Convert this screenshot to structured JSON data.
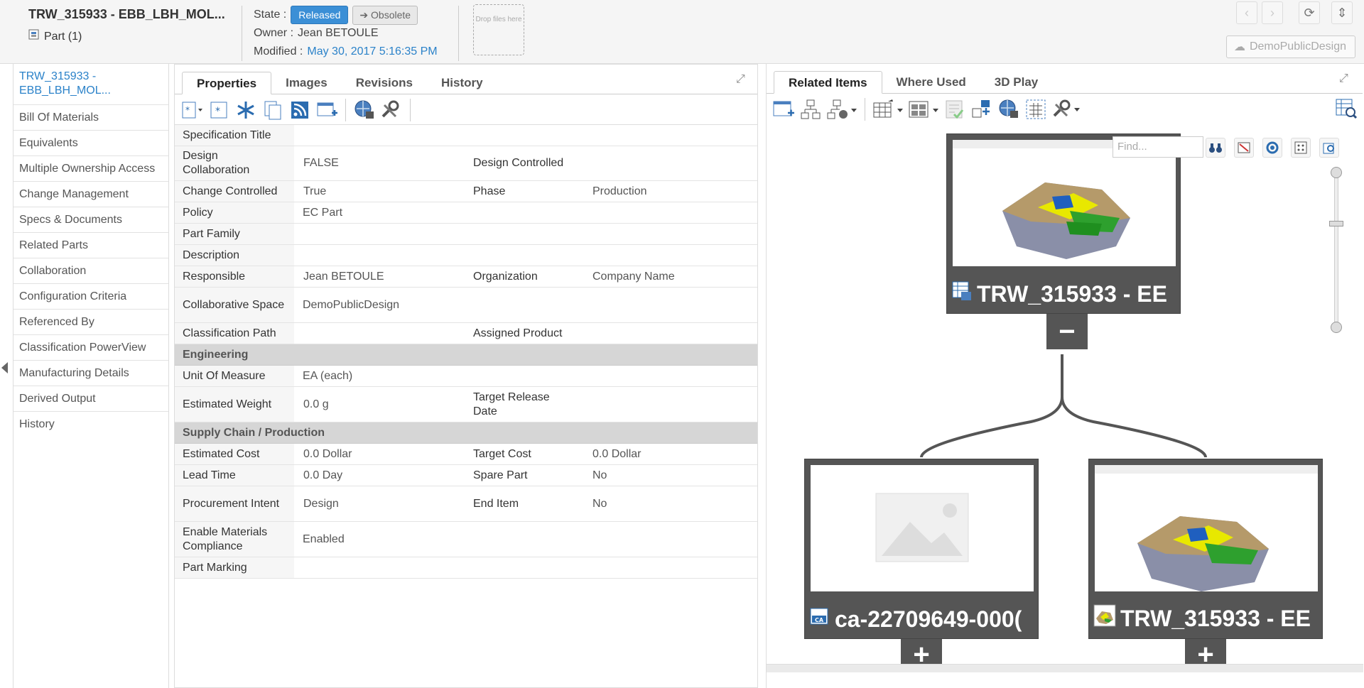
{
  "header": {
    "title": "TRW_315933 - EBB_LBH_MOL...",
    "type_label": "Part (1)",
    "state_label": "State :",
    "state_value": "Released",
    "obsolete_label": "Obsolete",
    "owner_label": "Owner :",
    "owner_value": "Jean BETOULE",
    "modified_label": "Modified :",
    "modified_value": "May 30, 2017 5:16:35 PM",
    "dropzone_text": "Drop files here",
    "workspace_label": "DemoPublicDesign"
  },
  "leftnav": {
    "active_line1": "TRW_315933 -",
    "active_line2": "EBB_LBH_MOL...",
    "items": [
      "Bill Of Materials",
      "Equivalents",
      "Multiple Ownership Access",
      "Change Management",
      "Specs & Documents",
      "Related Parts",
      "Collaboration",
      "Configuration Criteria",
      "Referenced By",
      "Classification PowerView",
      "Manufacturing Details",
      "Derived Output",
      "History"
    ]
  },
  "middle": {
    "tabs": [
      "Properties",
      "Images",
      "Revisions",
      "History"
    ],
    "properties": {
      "specification_title": {
        "label": "Specification Title",
        "value": ""
      },
      "design_collaboration": {
        "label": "Design Collaboration",
        "value": "FALSE"
      },
      "design_controlled": {
        "label": "Design Controlled",
        "value": ""
      },
      "change_controlled": {
        "label": "Change Controlled",
        "value": "True"
      },
      "phase": {
        "label": "Phase",
        "value": "Production"
      },
      "policy": {
        "label": "Policy",
        "value": "EC Part"
      },
      "part_family": {
        "label": "Part Family",
        "value": ""
      },
      "description": {
        "label": "Description",
        "value": ""
      },
      "responsible": {
        "label": "Responsible",
        "value": "Jean BETOULE"
      },
      "organization": {
        "label": "Organization",
        "value": "Company Name"
      },
      "collaborative_space": {
        "label": "Collaborative Space",
        "value": "DemoPublicDesign"
      },
      "classification_path": {
        "label": "Classification Path",
        "value": ""
      },
      "assigned_product": {
        "label": "Assigned Product",
        "value": ""
      },
      "section_engineering": "Engineering",
      "unit_of_measure": {
        "label": "Unit Of Measure",
        "value": "EA (each)"
      },
      "estimated_weight": {
        "label": "Estimated Weight",
        "value": "0.0 g"
      },
      "target_release_date": {
        "label": "Target Release Date",
        "value": ""
      },
      "section_supply": "Supply Chain / Production",
      "estimated_cost": {
        "label": "Estimated Cost",
        "value": "0.0 Dollar"
      },
      "target_cost": {
        "label": "Target Cost",
        "value": "0.0 Dollar"
      },
      "lead_time": {
        "label": "Lead Time",
        "value": "0.0 Day"
      },
      "spare_part": {
        "label": "Spare Part",
        "value": "No"
      },
      "procurement_intent": {
        "label": "Procurement Intent",
        "value": "Design"
      },
      "end_item": {
        "label": "End Item",
        "value": "No"
      },
      "enable_materials_compliance": {
        "label": "Enable Materials Compliance",
        "value": "Enabled"
      },
      "part_marking": {
        "label": "Part Marking",
        "value": ""
      }
    }
  },
  "right": {
    "tabs": [
      "Related Items",
      "Where Used",
      "3D Play"
    ],
    "find_placeholder": "Find...",
    "nodes": {
      "root_label": "TRW_315933 - EE",
      "child1_label": "ca-22709649-000(",
      "child2_label": "TRW_315933 - EE",
      "collapse_symbol": "−",
      "expand_symbol": "+"
    }
  },
  "colors": {
    "accent": "#3b8fd6",
    "link": "#2b82c9",
    "node_bg": "#555555"
  }
}
